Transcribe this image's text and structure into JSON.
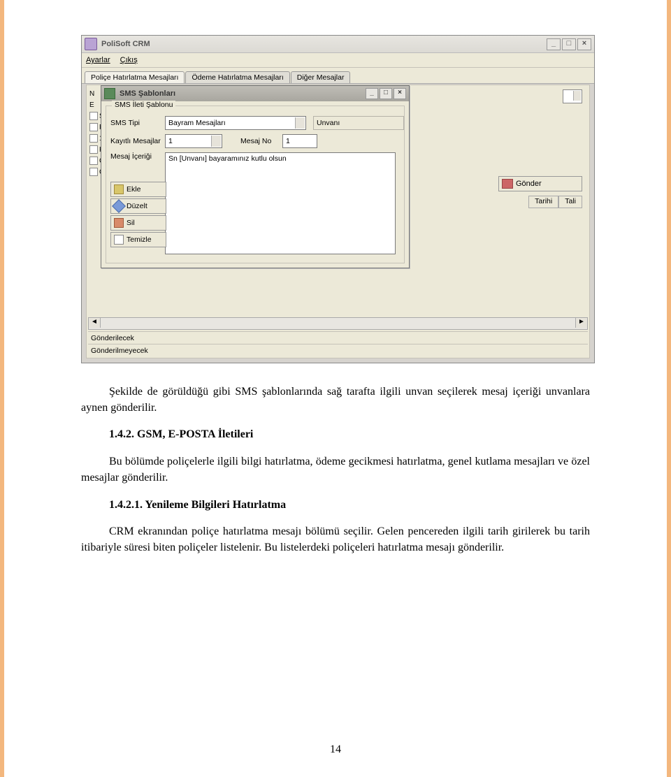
{
  "app": {
    "title": "PoliSoft CRM",
    "menu": {
      "ayarlar": "Ayarlar",
      "cikis": "Çıkış"
    },
    "tabs": {
      "police": "Poliçe Hatırlatma Mesajları",
      "odeme": "Ödeme Hatırlatma Mesajları",
      "diger": "Diğer Mesajlar"
    },
    "left_labels": [
      "N",
      "E",
      "S",
      "F",
      "1",
      "H",
      "C",
      "C"
    ],
    "gonder": "Gönder",
    "col_tarihi": "Tarihi",
    "col_tali": "Tali",
    "status1": "Gönderilecek",
    "status2": "Gönderilmeyecek"
  },
  "dialog": {
    "title": "SMS Şablonları",
    "group_label": "SMS İleti Şablonu",
    "sms_tipi_label": "SMS Tipi",
    "sms_tipi_value": "Bayram Mesajları",
    "kayitli_label": "Kayıtlı Mesajlar",
    "kayitli_value": "1",
    "mesaj_no_label": "Mesaj No",
    "mesaj_no_value": "1",
    "mesaj_icerigi_label": "Mesaj İçeriği",
    "mesaj_icerigi_value": "Sn [Unvanı]  bayaramınız kutlu olsun",
    "unvani": "Unvanı",
    "btn_ekle": "Ekle",
    "btn_duzelt": "Düzelt",
    "btn_sil": "Sil",
    "btn_temizle": "Temizle"
  },
  "doc": {
    "p1": "Şekilde de görüldüğü gibi SMS şablonlarında sağ tarafta ilgili unvan seçilerek mesaj içeriği unvanlara aynen gönderilir.",
    "h1": "1.4.2. GSM, E-POSTA İletileri",
    "p2": "Bu bölümde poliçelerle ilgili bilgi hatırlatma, ödeme gecikmesi hatırlatma, genel kutlama mesajları ve özel mesajlar gönderilir.",
    "h2": "1.4.2.1. Yenileme Bilgileri Hatırlatma",
    "p3": "CRM ekranından poliçe hatırlatma mesajı bölümü seçilir. Gelen pencereden ilgili tarih girilerek bu tarih itibariyle süresi biten poliçeler listelenir. Bu listelerdeki poliçeleri hatırlatma mesajı gönderilir.",
    "page_no": "14"
  }
}
